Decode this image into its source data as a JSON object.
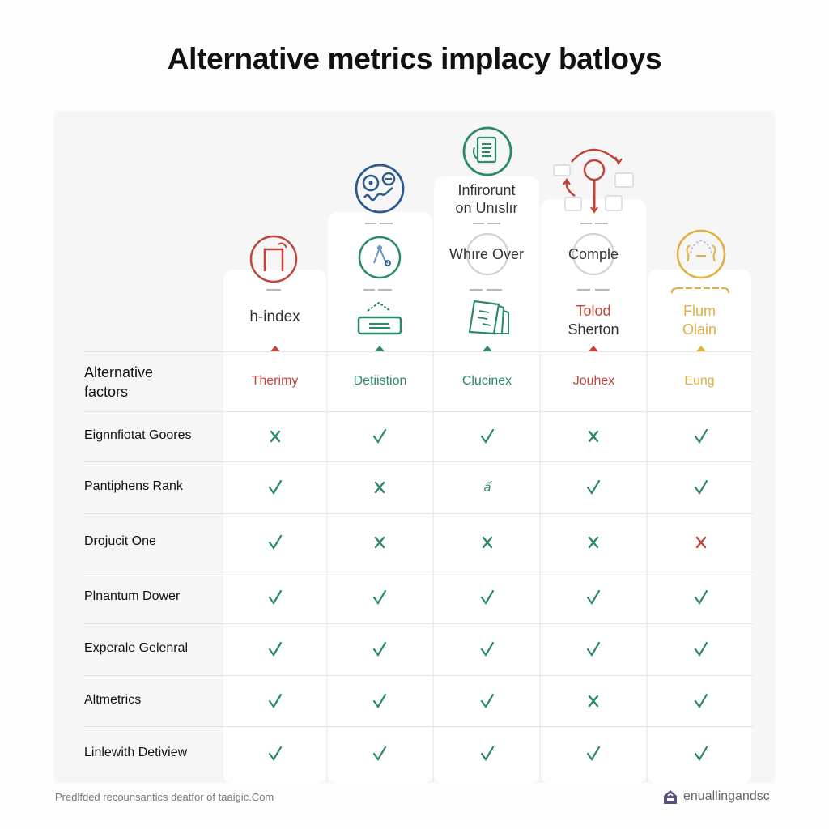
{
  "title": "Alternative metrics implacy batloys",
  "colors": {
    "red": "#c0443a",
    "green": "#2a8a68",
    "blue": "#2c5a8c",
    "gold": "#e0b040",
    "footer_icon": "#5b4f7c"
  },
  "columns": [
    {
      "id": "h-index",
      "top_labels": [],
      "name_lines": [
        "h-index"
      ],
      "subheader": "Therimy",
      "color": "red",
      "name_color": "dark",
      "icon": "bracket-arrow-icon"
    },
    {
      "id": "col2",
      "top_labels": [],
      "name_lines": [],
      "subheader": "Detiistion",
      "color": "green",
      "name_color": "dark",
      "icon": "network-icon",
      "top_icon": "face-icon",
      "bottom_icon": "keyboard-icon"
    },
    {
      "id": "col3",
      "top_labels": [
        "Infirorunt",
        "on Unıslır"
      ],
      "name_lines": [
        "Whıre Over"
      ],
      "subheader": "Clucinex",
      "color": "green",
      "name_color": "dark",
      "icon": "document-icon",
      "bottom_icon": "papers-icon"
    },
    {
      "id": "col4",
      "top_labels": [],
      "name_lines": [
        "Comple"
      ],
      "second_lines": [
        "Tolod",
        "Sherton"
      ],
      "subheader": "Jouhex",
      "color": "red",
      "name_color": "dark",
      "icon": "magnifier-cycle-icon"
    },
    {
      "id": "col5",
      "top_labels": [],
      "name_lines": [
        "Flum",
        "Olain"
      ],
      "subheader": "Eung",
      "color": "gold",
      "name_color": "gold",
      "icon": "wave-head-icon"
    }
  ],
  "table": {
    "header_label_lines": [
      "Alternative",
      "factors"
    ],
    "rows": [
      {
        "label": "Eignnfiotat Goores",
        "cells": [
          "cross",
          "check",
          "check",
          "cross",
          "check"
        ]
      },
      {
        "label": "Pantiphens Rank",
        "cells": [
          "check",
          "cross",
          "other",
          "check",
          "check"
        ]
      },
      {
        "label": "Drojucit One",
        "cells": [
          "check",
          "cross",
          "cross",
          "cross",
          "cross-red"
        ]
      },
      {
        "label": "Plnantum Dower",
        "cells": [
          "check",
          "check",
          "check",
          "check",
          "check"
        ]
      },
      {
        "label": "Experale Gelenral",
        "cells": [
          "check",
          "check",
          "check",
          "check",
          "check"
        ]
      },
      {
        "label": "Altmetrics",
        "cells": [
          "check",
          "check",
          "check",
          "cross",
          "check"
        ]
      },
      {
        "label": "Linlewith Detiview",
        "cells": [
          "check",
          "check",
          "check",
          "check",
          "check"
        ]
      }
    ],
    "other_glyph": "ấ"
  },
  "footer": {
    "left_text": "Predlfded recounsantics deatfor of taaigic.Com",
    "right_text": "enuallingandsc"
  }
}
